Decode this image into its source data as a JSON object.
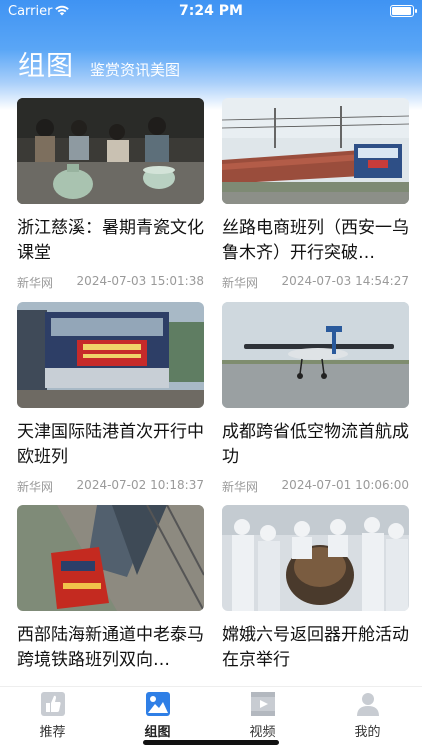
{
  "status_bar": {
    "carrier": "Carrier",
    "time": "7:24 PM"
  },
  "header": {
    "title": "组图",
    "subtitle": "鉴赏资讯美图"
  },
  "cards": [
    {
      "title": "浙江慈溪：暑期青瓷文化课堂",
      "source": "新华网",
      "time": "2024-07-03 15:01:38",
      "image": "ceramics-class-photo"
    },
    {
      "title": "丝路电商班列（西安一乌鲁木齐）开行突破…",
      "source": "新华网",
      "time": "2024-07-03 14:54:27",
      "image": "freight-train-photo"
    },
    {
      "title": "天津国际陆港首次开行中欧班列",
      "source": "新华网",
      "time": "2024-07-02 10:18:37",
      "image": "locomotive-photo"
    },
    {
      "title": "成都跨省低空物流首航成功",
      "source": "新华网",
      "time": "2024-07-01 10:06:00",
      "image": "cargo-plane-photo"
    },
    {
      "title": "西部陆海新通道中老泰马跨境铁路班列双向…",
      "source": "",
      "time": "",
      "image": "red-locomotive-photo"
    },
    {
      "title": "嫦娥六号返回器开舱活动在京举行",
      "source": "",
      "time": "",
      "image": "capsule-opening-photo"
    }
  ],
  "tabbar": {
    "items": [
      {
        "label": "推荐",
        "icon": "thumbs-up-icon"
      },
      {
        "label": "组图",
        "icon": "image-gallery-icon"
      },
      {
        "label": "视频",
        "icon": "video-icon"
      },
      {
        "label": "我的",
        "icon": "profile-icon"
      }
    ],
    "active_index": 1
  },
  "colors": {
    "header_gradient_top": "#3f93f3",
    "tab_active": "#2f7fe6",
    "tab_inactive": "#c8ccd2",
    "meta_text": "#9a9a9a"
  }
}
